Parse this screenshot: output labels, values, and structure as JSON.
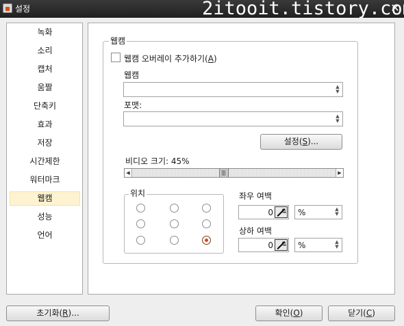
{
  "window": {
    "title": "설정",
    "watermark": "2itooit.tistory.com",
    "close_glyph": "✕"
  },
  "sidebar": {
    "items": [
      {
        "label": "녹화"
      },
      {
        "label": "소리"
      },
      {
        "label": "캡처"
      },
      {
        "label": "움짤"
      },
      {
        "label": "단축키"
      },
      {
        "label": "효과"
      },
      {
        "label": "저장"
      },
      {
        "label": "시간제한"
      },
      {
        "label": "워터마크"
      },
      {
        "label": "웹캠",
        "selected": true
      },
      {
        "label": "성능"
      },
      {
        "label": "언어"
      }
    ]
  },
  "webcam": {
    "group_title": "웹캠",
    "overlay_checkbox": {
      "label": "웹캠 오버레이 추가하기(",
      "mnemonic": "A",
      "label_end": ")",
      "checked": false
    },
    "webcam_label": "웹캠",
    "webcam_value": "",
    "format_label": "포맷:",
    "format_value": "",
    "settings_button": {
      "label": "설정(",
      "mnemonic": "S",
      "label_end": ")..."
    },
    "video_size": {
      "label": "비디오 크기: 45%",
      "percent": 45
    },
    "position": {
      "title": "위치",
      "selected_index": 8,
      "count": 9
    },
    "h_margin": {
      "label": "좌우 여백",
      "value": "0",
      "unit": "%"
    },
    "v_margin": {
      "label": "상하 여백",
      "value": "0",
      "unit": "%"
    }
  },
  "footer": {
    "reset": {
      "label": "초기화(",
      "mnemonic": "R",
      "label_end": ")..."
    },
    "ok": {
      "label": "확인(",
      "mnemonic": "O",
      "label_end": ")"
    },
    "close": {
      "label": "닫기(",
      "mnemonic": "C",
      "label_end": ")"
    }
  },
  "colors": {
    "selected_item_bg": "#fdf3d0",
    "radio_checked": "#e04010"
  }
}
